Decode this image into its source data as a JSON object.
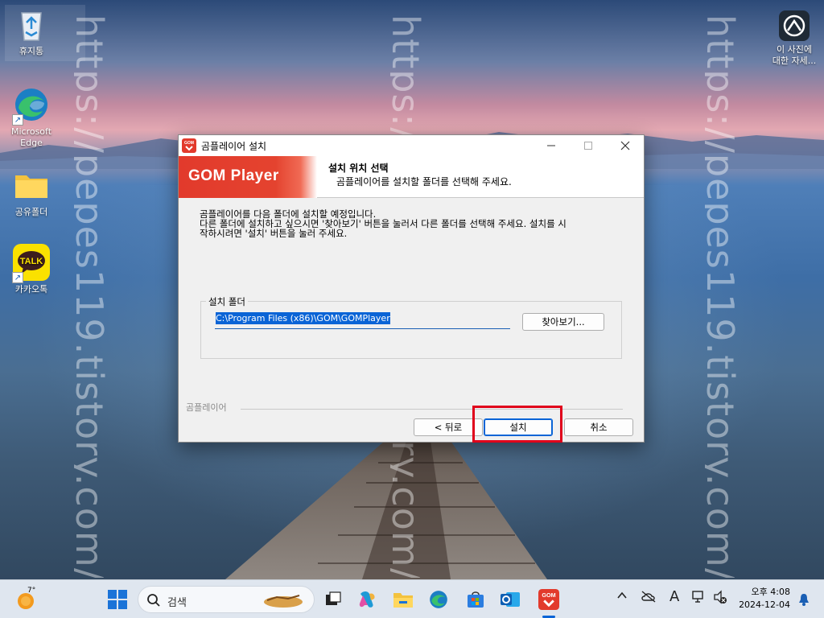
{
  "watermark": "https://pepes119.tistory.com/",
  "desktop_icons": {
    "recycle_bin": "휴지통",
    "edge_line1": "Microsoft",
    "edge_line2": "Edge",
    "shared_folder": "공유폴더",
    "kakaotalk": "카카오톡",
    "kakao_logo_text": "TALK",
    "photo_info_line1": "이 사진에",
    "photo_info_line2": "대한 자세..."
  },
  "installer": {
    "window_title": "곰플레이어 설치",
    "brand": "GOM Player",
    "icon_label": "GOM",
    "header_title": "설치 위치 선택",
    "header_subtitle": "곰플레이어를 설치할 폴더를 선택해 주세요.",
    "description_line1": "곰플레이어를 다음 폴더에 설치할 예정입니다.",
    "description_line2": "다른 폴더에 설치하고 싶으시면 '찾아보기' 버튼을 눌러서 다른 폴더를 선택해 주세요. 설치를 시",
    "description_line3": "작하시려면 '설치' 버튼을 눌러 주세요.",
    "group_label": "설치 폴더",
    "install_path": "C:\\Program Files (x86)\\GOM\\GOMPlayer",
    "browse_button": "찾아보기...",
    "footer_brand": "곰플레이어",
    "back_button": "< 뒤로",
    "install_button": "설치",
    "cancel_button": "취소"
  },
  "taskbar": {
    "weather_temp": "7°",
    "search_placeholder": "검색",
    "clock_time": "오후 4:08",
    "clock_date": "2024-12-04",
    "ime_indicator": "A"
  },
  "colors": {
    "gom_red": "#e23a2c",
    "selection_blue": "#0a64d6",
    "highlight_red": "#e0001b"
  }
}
